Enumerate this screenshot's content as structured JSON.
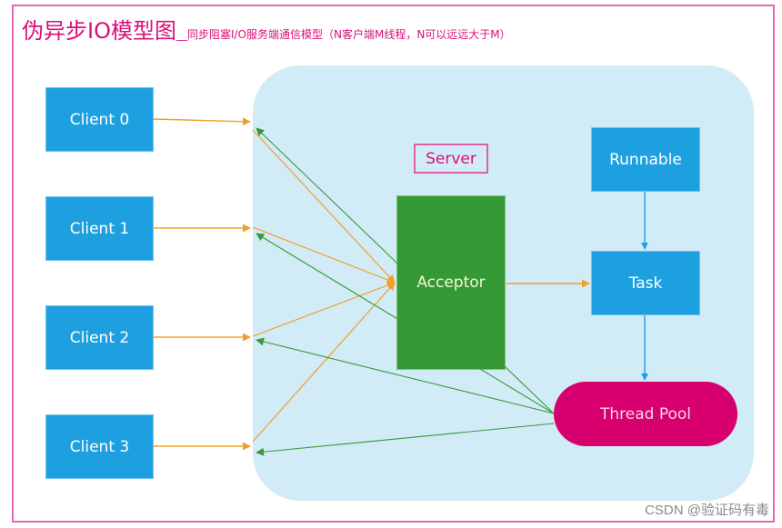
{
  "title": {
    "main": "伪异步IO模型图",
    "separator": "__",
    "subtitle": "同步阻塞I/O服务端通信模型（N客户端M线程，N可以远远大于M）"
  },
  "clients": [
    {
      "label": "Client 0"
    },
    {
      "label": "Client 1"
    },
    {
      "label": "Client 2"
    },
    {
      "label": "Client 3"
    }
  ],
  "server": {
    "label": "Server",
    "acceptor": "Acceptor",
    "runnable": "Runnable",
    "task": "Task",
    "thread_pool": "Thread Pool"
  },
  "colors": {
    "frame": "#e868b0",
    "title": "#d8107a",
    "server_bg": "#d1ebf7",
    "node_blue": "#1ea0e0",
    "acceptor_green": "#359a35",
    "thread_pool": "#d8006f",
    "request_arrow": "#f0a028",
    "response_arrow": "#3a9a3a",
    "flow_arrow": "#1ea0e0"
  },
  "watermark": "CSDN @验证码有毒"
}
